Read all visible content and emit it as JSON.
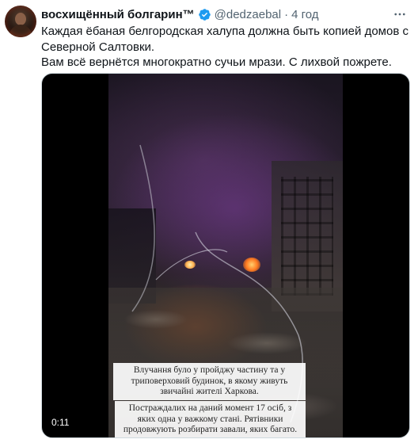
{
  "tweet": {
    "display_name": "восхищённый болгарин™",
    "handle": "@dedzaebal",
    "separator": "·",
    "time": "4 год",
    "text_lines": [
      "Каждая ёбаная белгородская халупа должна быть копией домов с Северной Салтовки.",
      "Вам всё вернётся многократно сучьи мрази. С лихвой пожрете."
    ]
  },
  "media": {
    "type": "video",
    "elapsed": "0:11",
    "captions": [
      "Влучання було у пройджу частину та у триповерховий будинок, в якому живуть звичайні жителі Харкова.",
      "Постраждалих на даний момент 17 осіб, з яких одна у важкому стані. Рятівники продовжують розбирати завали, яких багато."
    ]
  },
  "icons": {
    "verified": "verified-badge-icon",
    "more": "more-horizontal-icon"
  },
  "colors": {
    "verified_blue": "#1d9bf0",
    "secondary_text": "#536471",
    "primary_text": "#0f1419"
  }
}
